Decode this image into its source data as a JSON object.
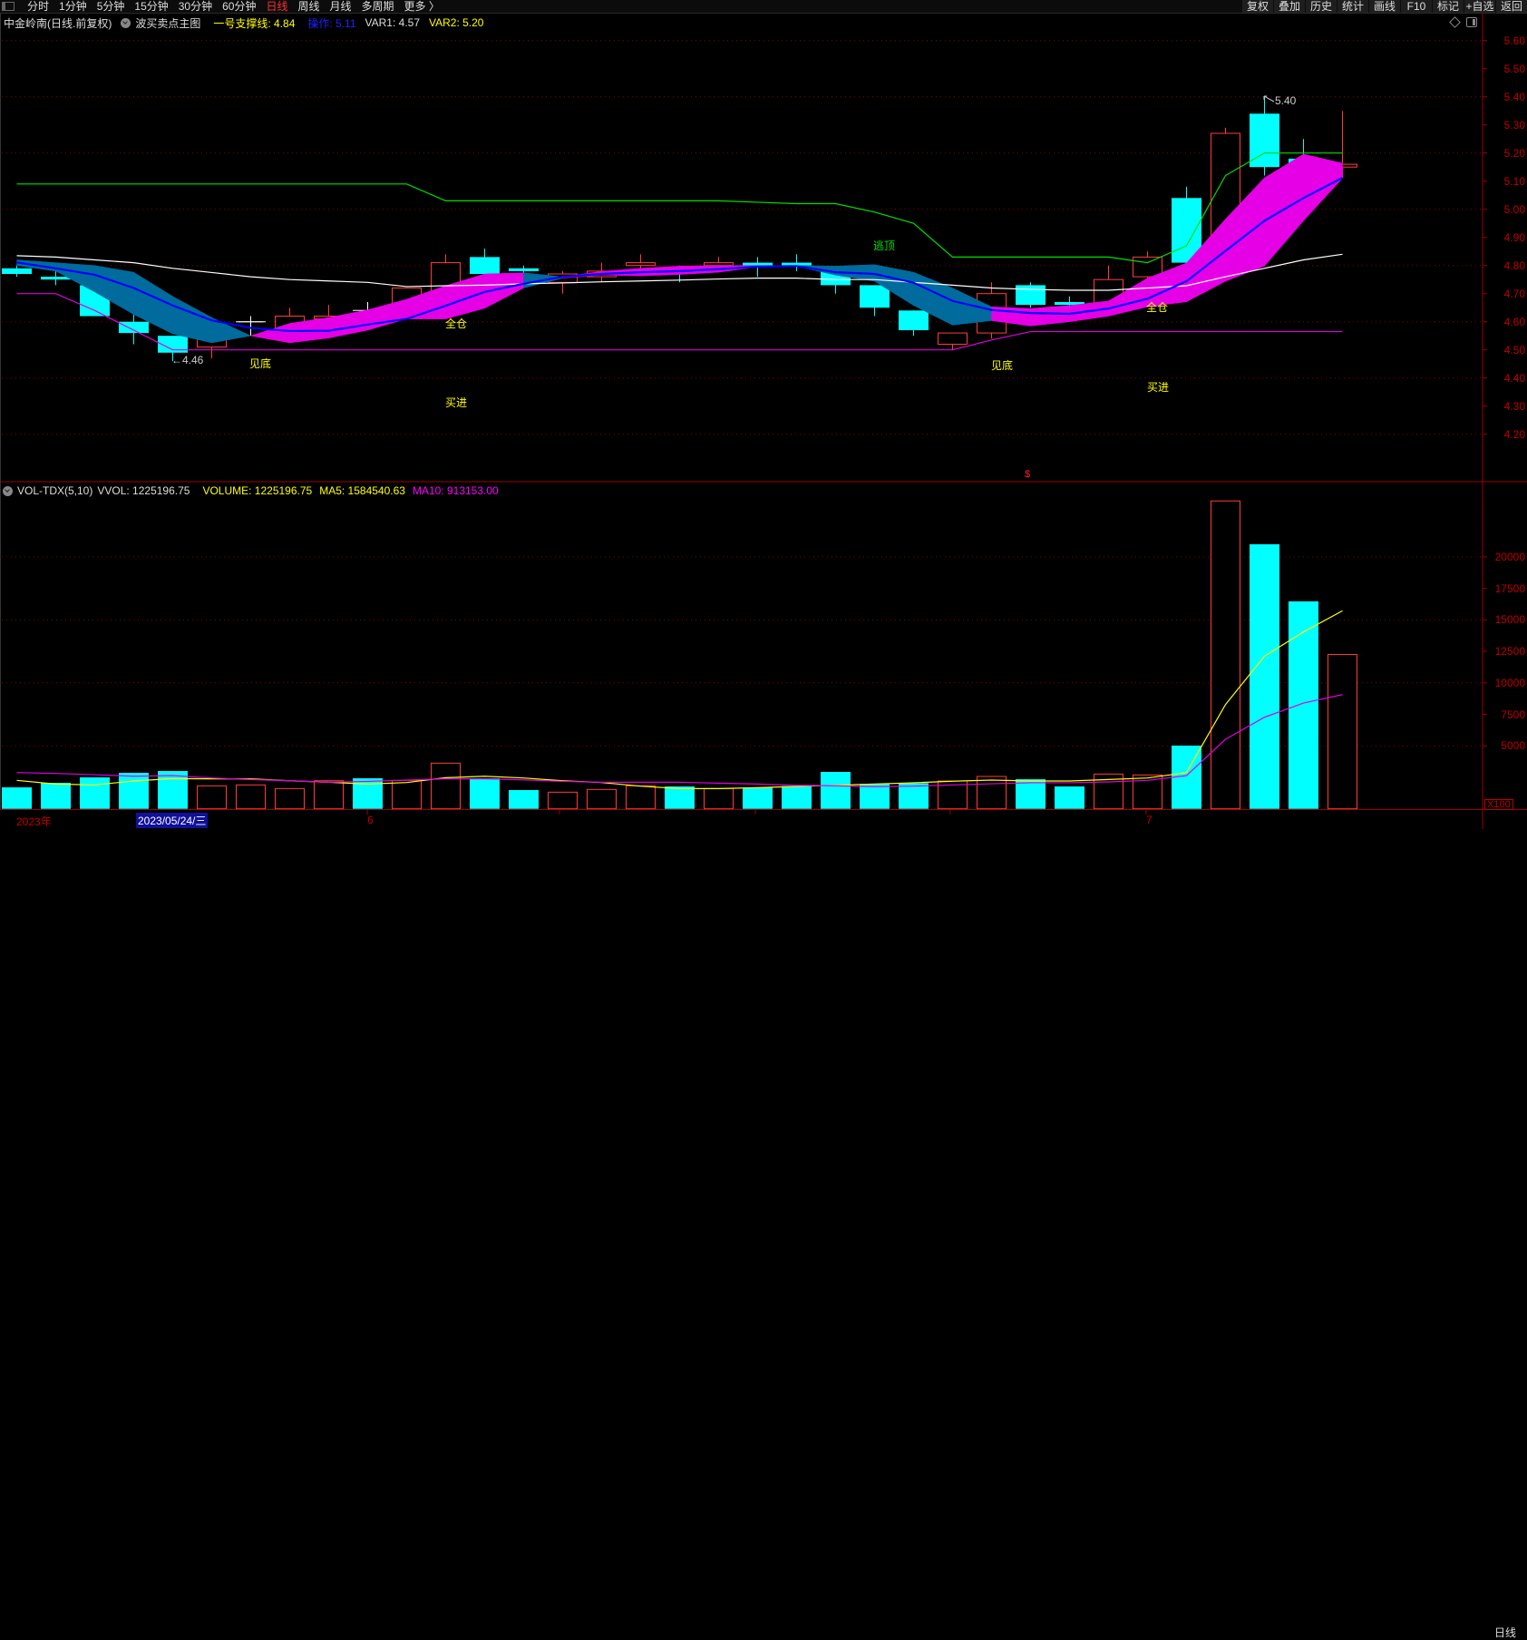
{
  "toolbar": {
    "periods": [
      "分时",
      "1分钟",
      "5分钟",
      "15分钟",
      "30分钟",
      "60分钟",
      "日线",
      "周线",
      "月线",
      "多周期",
      "更多 〉"
    ],
    "active_period": "日线",
    "right_buttons": [
      "复权",
      "叠加",
      "历史",
      "统计",
      "画线",
      "F10",
      "标记",
      "+自选",
      "返回"
    ]
  },
  "main_header": {
    "title": "中金岭南(日线.前复权)",
    "indicator": "波买卖点主图",
    "support": "一号支撑线: 4.84",
    "operate": "操作: 5.11",
    "var1": "VAR1: 4.57",
    "var2": "VAR2: 5.20"
  },
  "volume_header": {
    "name": "VOL-TDX(5,10)",
    "vvol": "VVOL: 1225196.75",
    "volume": "VOLUME: 1225196.75",
    "ma5": "MA5: 1584540.63",
    "ma10": "MA10: 913153.00"
  },
  "colors": {
    "up": "#ff3c3c",
    "down": "#00ffff",
    "doji": "#ffffff",
    "band_down": "#006b9c",
    "band_up": "#e600e6",
    "blue": "#0000ff",
    "green": "#00e000",
    "white": "#ffffff",
    "magenta": "#e000e0",
    "yellow": "#ffff00",
    "axis": "#c00000"
  },
  "price_axis": {
    "labels": [
      "5.60",
      "5.50",
      "5.40",
      "5.30",
      "5.20",
      "5.10",
      "5.00",
      "4.90",
      "4.80",
      "4.70",
      "4.60",
      "4.50",
      "4.40",
      "4.30",
      "4.20"
    ],
    "min": 4.2,
    "max": 5.6
  },
  "volume_axis": {
    "labels": [
      "20000",
      "17500",
      "15000",
      "12500",
      "10000",
      "7500",
      "5000"
    ],
    "unit": "X100"
  },
  "annotations": {
    "low_label": "←4.46",
    "high_label": "5.40",
    "signals": [
      "见底",
      "全仓",
      "买进",
      "逃顶",
      "见底",
      "全仓",
      "买进"
    ],
    "marker": "$"
  },
  "date_bar": {
    "year": "2023年",
    "selected": "2023/05/24/三",
    "month6": "6",
    "month7": "7",
    "period": "日线"
  },
  "chart_data": {
    "type": "candlestick",
    "ohlc": [
      [
        4.79,
        4.8,
        4.76,
        4.77
      ],
      [
        4.76,
        4.78,
        4.73,
        4.75
      ],
      [
        4.73,
        4.73,
        4.62,
        4.62
      ],
      [
        4.6,
        4.63,
        4.52,
        4.56
      ],
      [
        4.55,
        4.55,
        4.46,
        4.49
      ],
      [
        4.51,
        4.54,
        4.47,
        4.54
      ],
      [
        4.6,
        4.62,
        4.55,
        4.6
      ],
      [
        4.57,
        4.65,
        4.57,
        4.62
      ],
      [
        4.61,
        4.66,
        4.6,
        4.62
      ],
      [
        4.64,
        4.67,
        4.62,
        4.64
      ],
      [
        4.65,
        4.72,
        4.65,
        4.72
      ],
      [
        4.71,
        4.84,
        4.7,
        4.81
      ],
      [
        4.83,
        4.86,
        4.77,
        4.77
      ],
      [
        4.79,
        4.8,
        4.77,
        4.78
      ],
      [
        4.74,
        4.78,
        4.7,
        4.77
      ],
      [
        4.76,
        4.81,
        4.74,
        4.78
      ],
      [
        4.8,
        4.84,
        4.79,
        4.81
      ],
      [
        4.79,
        4.8,
        4.74,
        4.78
      ],
      [
        4.8,
        4.83,
        4.79,
        4.81
      ],
      [
        4.81,
        4.83,
        4.76,
        4.8
      ],
      [
        4.81,
        4.84,
        4.78,
        4.8
      ],
      [
        4.79,
        4.79,
        4.7,
        4.73
      ],
      [
        4.73,
        4.73,
        4.62,
        4.65
      ],
      [
        4.64,
        4.64,
        4.55,
        4.57
      ],
      [
        4.52,
        4.56,
        4.5,
        4.56
      ],
      [
        4.56,
        4.74,
        4.54,
        4.7
      ],
      [
        4.73,
        4.74,
        4.65,
        4.66
      ],
      [
        4.67,
        4.69,
        4.64,
        4.66
      ],
      [
        4.66,
        4.8,
        4.62,
        4.75
      ],
      [
        4.76,
        4.85,
        4.75,
        4.83
      ],
      [
        5.04,
        5.08,
        4.8,
        4.81
      ],
      [
        4.82,
        5.29,
        4.81,
        5.27
      ],
      [
        5.34,
        5.4,
        5.12,
        5.15
      ],
      [
        5.18,
        5.25,
        4.96,
        5.16
      ],
      [
        5.15,
        5.35,
        5.11,
        5.16
      ]
    ],
    "band_upper": [
      4.82,
      4.81,
      4.8,
      4.776,
      4.69,
      4.615,
      4.55,
      4.594,
      4.615,
      4.642,
      4.68,
      4.728,
      4.77,
      4.774,
      4.76,
      4.779,
      4.79,
      4.798,
      4.8,
      4.8,
      4.8,
      4.798,
      4.803,
      4.776,
      4.72,
      4.653,
      4.647,
      4.658,
      4.674,
      4.755,
      4.809,
      4.965,
      5.112,
      5.196,
      5.164
    ],
    "band_lower": [
      4.8,
      4.78,
      4.706,
      4.626,
      4.557,
      4.525,
      4.55,
      4.525,
      4.542,
      4.57,
      4.61,
      4.61,
      4.648,
      4.72,
      4.755,
      4.766,
      4.763,
      4.768,
      4.776,
      4.795,
      4.797,
      4.766,
      4.744,
      4.658,
      4.588,
      4.604,
      4.585,
      4.6,
      4.62,
      4.653,
      4.671,
      4.744,
      4.798,
      4.959,
      5.11
    ],
    "band_trend": [
      "down",
      "down",
      "down",
      "down",
      "down",
      "down",
      "up",
      "up",
      "up",
      "up",
      "up",
      "up",
      "up",
      "down",
      "up",
      "up",
      "up",
      "up",
      "up",
      "up",
      "down",
      "down",
      "down",
      "down",
      "down",
      "up",
      "up",
      "up",
      "up",
      "up",
      "up",
      "up",
      "up",
      "up"
    ],
    "operate_line": [
      4.811,
      4.79,
      4.767,
      4.72,
      4.658,
      4.605,
      4.578,
      4.567,
      4.568,
      4.59,
      4.61,
      4.657,
      4.706,
      4.735,
      4.76,
      4.77,
      4.776,
      4.78,
      4.787,
      4.796,
      4.798,
      4.776,
      4.77,
      4.739,
      4.674,
      4.642,
      4.631,
      4.628,
      4.647,
      4.682,
      4.744,
      4.852,
      4.959,
      5.04,
      5.112
    ],
    "green_line": [
      5.09,
      5.09,
      5.09,
      5.09,
      5.09,
      5.09,
      5.09,
      5.09,
      5.09,
      5.09,
      5.09,
      5.03,
      5.03,
      5.03,
      5.03,
      5.03,
      5.03,
      5.03,
      5.03,
      5.025,
      5.02,
      5.02,
      4.99,
      4.95,
      4.83,
      4.83,
      4.83,
      4.83,
      4.83,
      4.81,
      4.87,
      5.12,
      5.2,
      5.2,
      5.2
    ],
    "white_line": [
      4.835,
      4.83,
      4.82,
      4.81,
      4.79,
      4.775,
      4.76,
      4.75,
      4.745,
      4.74,
      4.725,
      4.728,
      4.73,
      4.735,
      4.738,
      4.742,
      4.745,
      4.748,
      4.752,
      4.755,
      4.755,
      4.75,
      4.75,
      4.74,
      4.73,
      4.72,
      4.715,
      4.712,
      4.712,
      4.72,
      4.728,
      4.76,
      4.79,
      4.82,
      4.84
    ],
    "magenta_line": [
      4.7,
      4.7,
      4.64,
      4.57,
      4.5,
      4.5,
      4.5,
      4.5,
      4.5,
      4.5,
      4.5,
      4.5,
      4.5,
      4.5,
      4.5,
      4.5,
      4.5,
      4.5,
      4.5,
      4.5,
      4.5,
      4.5,
      4.5,
      4.5,
      4.5,
      4.535,
      4.565,
      4.565,
      4.565,
      4.565,
      4.565,
      4.565,
      4.565,
      4.565,
      4.565
    ],
    "volume": [
      1706,
      2066,
      2498,
      2858,
      3002,
      1826,
      1898,
      1610,
      2230,
      2426,
      2258,
      3626,
      2426,
      1490,
      1322,
      1538,
      1826,
      1778,
      1610,
      1680,
      1800,
      2930,
      1970,
      2040,
      2210,
      2570,
      2350,
      1780,
      2760,
      2690,
      5020,
      24440,
      21000,
      16470,
      12252
    ],
    "volume_dir": [
      "down",
      "down",
      "down",
      "down",
      "down",
      "up",
      "up",
      "up",
      "up",
      "down",
      "up",
      "up",
      "down",
      "down",
      "up",
      "up",
      "up",
      "down",
      "up",
      "down",
      "down",
      "down",
      "down",
      "down",
      "up",
      "up",
      "down",
      "down",
      "up",
      "up",
      "down",
      "up",
      "down",
      "down",
      "up"
    ],
    "vol_ma5": [
      2260,
      1970,
      1900,
      2210,
      2400,
      2380,
      2380,
      2230,
      2110,
      1970,
      2090,
      2470,
      2590,
      2450,
      2230,
      2090,
      1800,
      1610,
      1610,
      1680,
      1780,
      1870,
      1970,
      2070,
      2190,
      2280,
      2210,
      2210,
      2330,
      2450,
      2880,
      8280,
      12120,
      14040,
      15720
    ],
    "vol_ma10": [
      2880,
      2810,
      2710,
      2590,
      2640,
      2450,
      2330,
      2230,
      2110,
      2180,
      2280,
      2380,
      2380,
      2300,
      2180,
      2110,
      2110,
      2110,
      2040,
      1970,
      1870,
      1830,
      1760,
      1800,
      1900,
      1990,
      2070,
      2070,
      2140,
      2260,
      2640,
      5520,
      7270,
      8400,
      9070
    ]
  }
}
